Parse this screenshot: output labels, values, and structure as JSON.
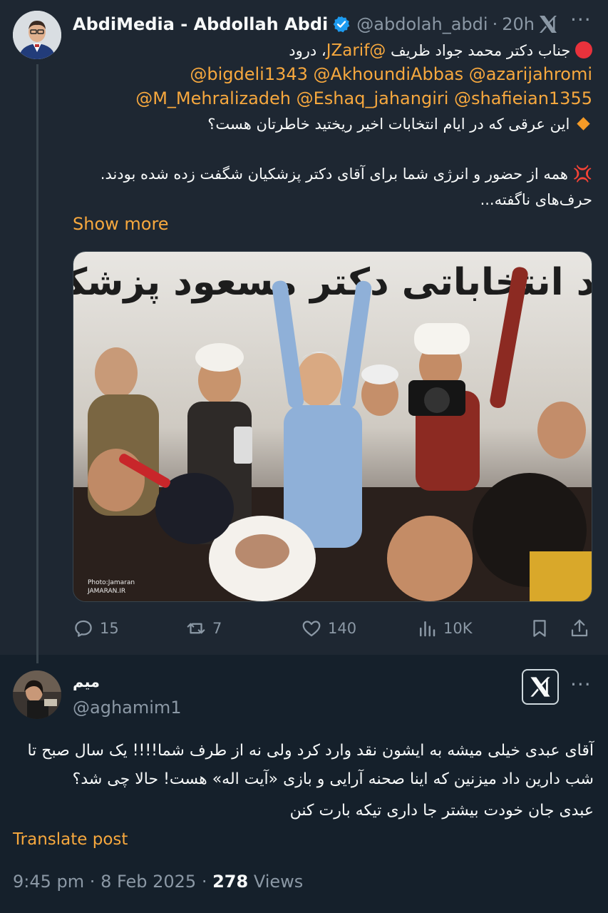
{
  "tweet": {
    "display_name": "AbdiMedia - Abdollah Abdi",
    "handle": "@abdolah_abdi",
    "sep": "·",
    "time_ago": "20h",
    "line1_text": "جناب دکتر محمد جواد ظریف ",
    "line1_mention": "@JZarif",
    "line1_suffix": "، درود",
    "mentions_line1": "@bigdeli1343 @AkhoundiAbbas @azarijahromi",
    "mentions_line2": "@M_Mehralizadeh @Eshaq_jahangiri @shafieian1355",
    "line2": "این عرقی که در ایام انتخابات اخیر ریختید خاطرتان هست؟",
    "line3": "همه از حضور و انرژی شما برای آقای دکتر پزشکیان شگفت زده شده بودند.",
    "line4": "حرف‌های ناگفته...",
    "show_more": "Show more",
    "photo": {
      "banner_text": "ستاد انتخاباتی دکتر مسعود پزشکیان",
      "credit_line1": "Photo:Jamaran",
      "credit_line2": "JAMARAN.IR"
    },
    "stats": {
      "replies": "15",
      "reposts": "7",
      "likes": "140",
      "views": "10K"
    }
  },
  "reply": {
    "display_name": "میم",
    "handle": "@aghamim1",
    "lines": [
      "آقای عبدی خیلی میشه به ایشون نقد وارد کرد ولی نه از طرف شما!!!! یک سال صبح تا",
      "شب دارین داد میزنین که اینا صحنه آرایی و بازی «آیت اله» هست! حالا چی شد؟",
      "عبدی جان خودت بیشتر جا داری تیکه بارت کنن"
    ],
    "translate": "Translate post",
    "time": "9:45 pm",
    "date": "8 Feb 2025",
    "views_count": "278",
    "views_label": "Views"
  },
  "colors": {
    "background": "#15202b",
    "tweet_background": "#1e2732",
    "accent_orange": "#f7a83e",
    "muted": "#8b98a5",
    "verified_blue": "#1d9bf0"
  },
  "icons": [
    "verified-badge-icon",
    "x-logo-icon",
    "more-icon",
    "reply-icon",
    "repost-icon",
    "like-icon",
    "views-icon",
    "bookmark-icon",
    "share-icon",
    "red-circle-icon",
    "orange-diamond-icon",
    "anger-icon"
  ]
}
